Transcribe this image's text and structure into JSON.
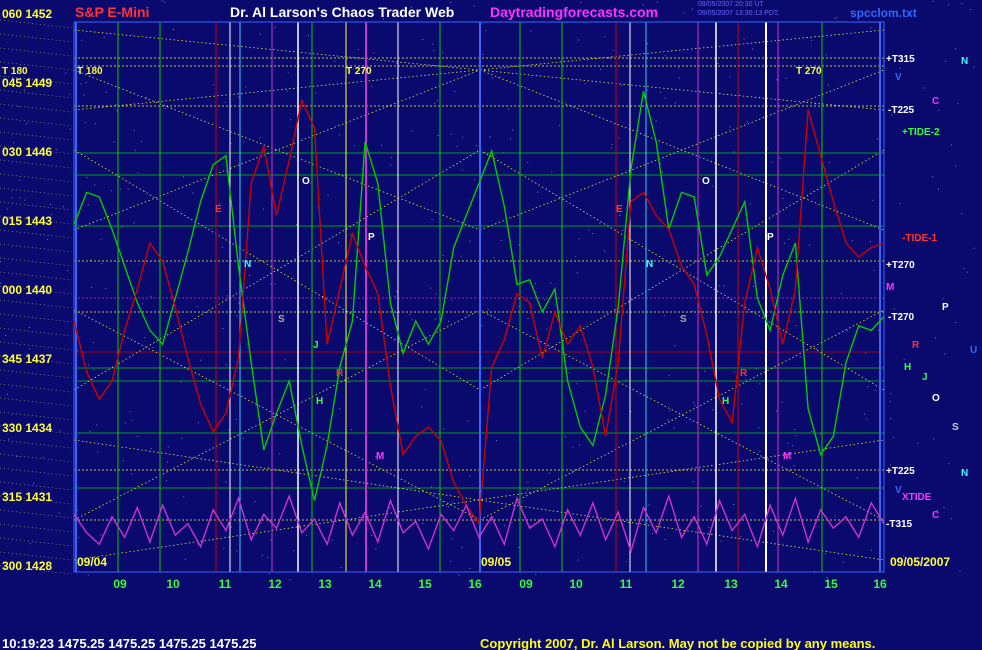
{
  "header": {
    "symbol_label": "S&P E-Mini",
    "title": "Dr. Al Larson's Chaos Trader Web",
    "site": "Daytradingforecasts.com",
    "timestamp_line1": "09/05/2007 20:30 UT",
    "timestamp_line2": "09/05/2007 13:30:13 PDT",
    "filename": "spcclom.txt"
  },
  "footer": {
    "quote": "10:19:23  1475.25  1475.25  1475.25  1475.25",
    "copyright": "Copyright 2007, Dr. Al Larson. May not be copied by any means."
  },
  "colors": {
    "background": "#0a0a6e",
    "price_line": "#00cc00",
    "tide_line": "#cc0000",
    "xtide_line": "#cc33cc",
    "grid_yellow": "#ffff33",
    "accent_magenta": "#ff33ff",
    "header_red": "#ff3333",
    "copyright_yellow": "#ffff00"
  },
  "chart_data": {
    "type": "line",
    "price_axis": {
      "rows": [
        {
          "code": "060",
          "price": "1452"
        },
        {
          "code": "045",
          "price": "1449"
        },
        {
          "code": "030",
          "price": "1446"
        },
        {
          "code": "015",
          "price": "1443"
        },
        {
          "code": "000",
          "price": "1440"
        },
        {
          "code": "345",
          "price": "1437"
        },
        {
          "code": "330",
          "price": "1434"
        },
        {
          "code": "315",
          "price": "1431"
        },
        {
          "code": "300",
          "price": "1428"
        }
      ],
      "ylim": [
        1428,
        1452
      ]
    },
    "time_axis": {
      "ticks": [
        "09",
        "10",
        "11",
        "12",
        "13",
        "14",
        "15",
        "16",
        "09",
        "10",
        "11",
        "12",
        "13",
        "14",
        "15",
        "16"
      ],
      "session_labels": [
        "09/04",
        "09/05"
      ],
      "end_date": "09/05/2007"
    },
    "top_labels": [
      "T 180",
      "T 180",
      "T 270",
      "T 270"
    ],
    "right_labels": {
      "lines": [
        "+T315",
        "-T225",
        "+TIDE-2",
        "-TIDE-1",
        "+T270",
        "-T270",
        "+T225",
        "XTIDE",
        "-T315"
      ],
      "planets": [
        "N",
        "V",
        "C",
        "P",
        "U",
        "R",
        "H",
        "J",
        "O",
        "S",
        "N",
        "V",
        "C",
        "M"
      ]
    },
    "markers": [
      "E",
      "N",
      "O",
      "S",
      "P",
      "M",
      "H",
      "J",
      "R",
      "E",
      "N",
      "O",
      "S",
      "P",
      "M",
      "H",
      "R"
    ],
    "series": [
      {
        "name": "price",
        "x": [
          0,
          1,
          2,
          3,
          4,
          5,
          6,
          7,
          8,
          9,
          10,
          11,
          12,
          13,
          14,
          15,
          16,
          17,
          18,
          19,
          20,
          21,
          22,
          23,
          24,
          25,
          26,
          27,
          28,
          29,
          30,
          31,
          32,
          33,
          34,
          35,
          36,
          37,
          38,
          39,
          40,
          41,
          42,
          43,
          44,
          45,
          46,
          47,
          48,
          49,
          50,
          51,
          52,
          53,
          54,
          55,
          56,
          57,
          58,
          59,
          60,
          61,
          62,
          63,
          64
        ],
        "values": [
          1442.8,
          1444.2,
          1444.0,
          1442.6,
          1441.0,
          1439.4,
          1438.2,
          1437.6,
          1439.6,
          1441.6,
          1443.8,
          1445.4,
          1445.8,
          1441.0,
          1436.8,
          1433.0,
          1434.6,
          1436.0,
          1433.2,
          1430.8,
          1433.2,
          1436.6,
          1438.6,
          1446.4,
          1444.6,
          1439.4,
          1437.2,
          1438.6,
          1437.6,
          1438.6,
          1441.8,
          1443.2,
          1444.6,
          1446.0,
          1443.6,
          1440.2,
          1440.4,
          1439.0,
          1440.0,
          1436.0,
          1434.0,
          1433.2,
          1435.4,
          1439.2,
          1445.2,
          1448.6,
          1446.4,
          1442.6,
          1444.2,
          1444.0,
          1440.6,
          1441.4,
          1442.6,
          1443.8,
          1439.6,
          1438.2,
          1440.6,
          1442.0,
          1434.8,
          1432.8,
          1433.6,
          1436.8,
          1438.4,
          1438.2,
          1438.8
        ]
      },
      {
        "name": "tide",
        "x": [
          0,
          1,
          2,
          3,
          4,
          5,
          6,
          7,
          8,
          9,
          10,
          11,
          12,
          13,
          14,
          15,
          16,
          17,
          18,
          19,
          20,
          21,
          22,
          23,
          24,
          25,
          26,
          27,
          28,
          29,
          30,
          31,
          32,
          33,
          34,
          35,
          36,
          37,
          38,
          39,
          40,
          41,
          42,
          43,
          44,
          45,
          46,
          47,
          48,
          49,
          50,
          51,
          52,
          53,
          54,
          55,
          56,
          57,
          58,
          59,
          60,
          61,
          62,
          63,
          64
        ],
        "values": [
          1438.6,
          1436.4,
          1435.2,
          1436.0,
          1438.2,
          1440.0,
          1442.0,
          1441.2,
          1439.2,
          1437.0,
          1435.0,
          1433.8,
          1434.6,
          1437.0,
          1444.6,
          1446.2,
          1443.2,
          1445.6,
          1448.2,
          1447.0,
          1437.6,
          1440.0,
          1442.4,
          1441.0,
          1439.8,
          1435.8,
          1432.8,
          1433.6,
          1434.0,
          1433.4,
          1431.6,
          1430.6,
          1429.8,
          1436.6,
          1437.8,
          1439.8,
          1439.4,
          1437.0,
          1439.0,
          1437.6,
          1438.4,
          1436.6,
          1433.6,
          1436.8,
          1443.8,
          1444.2,
          1443.2,
          1442.6,
          1441.0,
          1440.2,
          1438.0,
          1435.2,
          1434.2,
          1439.4,
          1441.8,
          1440.0,
          1437.6,
          1440.0,
          1447.8,
          1445.8,
          1443.8,
          1442.0,
          1441.4,
          1441.8,
          1442.0
        ]
      },
      {
        "name": "xtide",
        "x": [
          0,
          1,
          2,
          3,
          4,
          5,
          6,
          7,
          8,
          9,
          10,
          11,
          12,
          13,
          14,
          15,
          16,
          17,
          18,
          19,
          20,
          21,
          22,
          23,
          24,
          25,
          26,
          27,
          28,
          29,
          30,
          31,
          32,
          33,
          34,
          35,
          36,
          37,
          38,
          39,
          40,
          41,
          42,
          43,
          44,
          45,
          46,
          47,
          48,
          49,
          50,
          51,
          52,
          53,
          54,
          55,
          56,
          57,
          58,
          59,
          60,
          61,
          62,
          63,
          64
        ],
        "values": [
          1430.2,
          1429.4,
          1428.9,
          1430.1,
          1429.2,
          1430.5,
          1429.0,
          1430.6,
          1429.3,
          1429.8,
          1428.8,
          1430.4,
          1429.5,
          1430.9,
          1429.1,
          1430.2,
          1429.6,
          1431.0,
          1429.4,
          1430.0,
          1428.9,
          1430.7,
          1429.3,
          1430.3,
          1429.0,
          1430.8,
          1429.4,
          1429.9,
          1428.7,
          1430.2,
          1429.5,
          1430.6,
          1429.2,
          1430.1,
          1428.9,
          1430.9,
          1429.6,
          1430.0,
          1428.8,
          1430.4,
          1429.3,
          1430.7,
          1429.1,
          1430.3,
          1428.6,
          1430.5,
          1429.4,
          1431.0,
          1429.2,
          1430.1,
          1428.9,
          1430.8,
          1429.5,
          1430.2,
          1428.8,
          1430.6,
          1429.3,
          1430.9,
          1429.0,
          1430.4,
          1429.6,
          1430.1,
          1429.2,
          1430.7,
          1429.8
        ]
      }
    ]
  }
}
